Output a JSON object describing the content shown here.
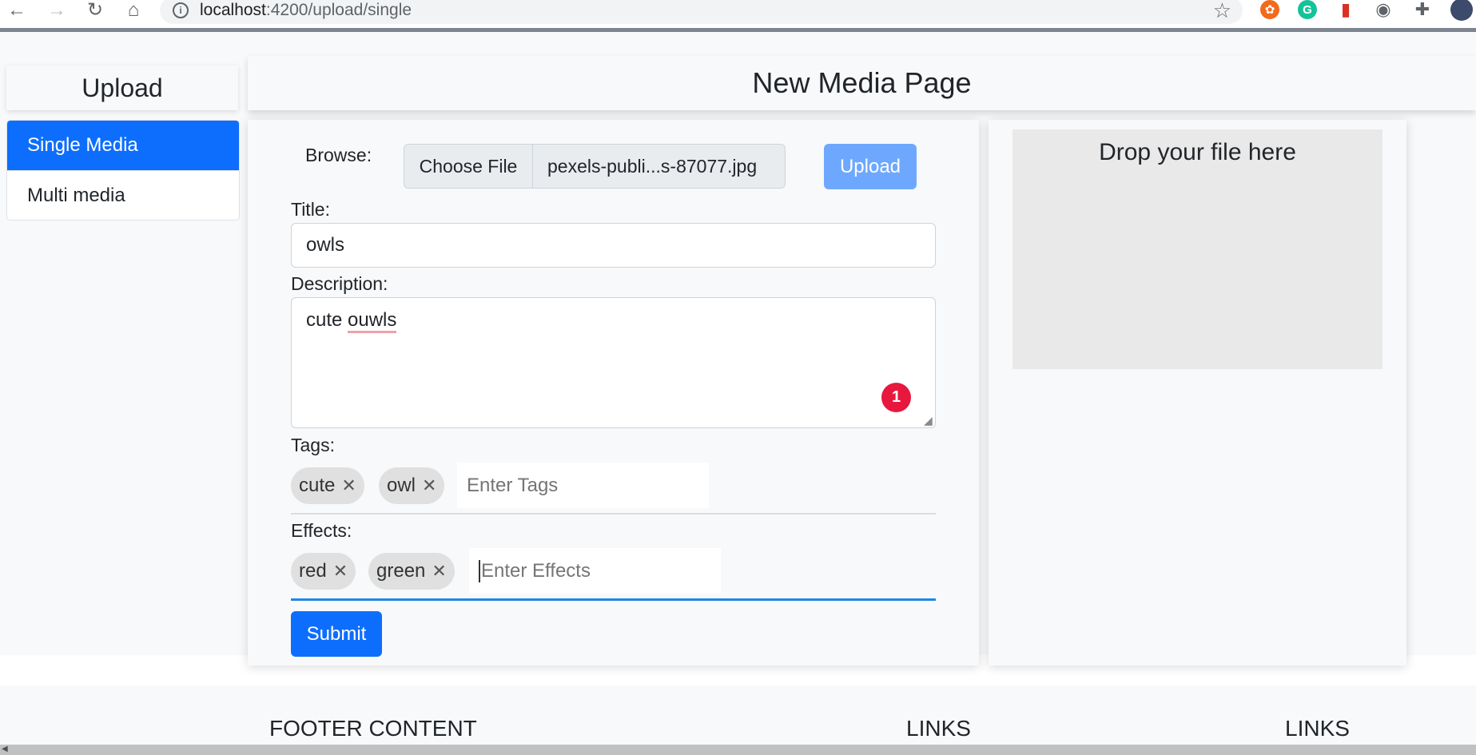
{
  "browser": {
    "url_host": "localhost",
    "url_path": ":4200/upload/single",
    "back_icon": "←",
    "forward_icon": "→",
    "reload_icon": "↻",
    "home_icon": "⌂",
    "info_icon": "i",
    "star_icon": "☆",
    "extensions": [
      {
        "name": "ublock-icon",
        "glyph": "✿",
        "color": "#f26b1d"
      },
      {
        "name": "grammarly-icon",
        "glyph": "G",
        "color": "#15c39a"
      },
      {
        "name": "bookmark-ext-icon",
        "glyph": "▮",
        "color": "#d93025"
      },
      {
        "name": "screencast-icon",
        "glyph": "◉",
        "color": "#5f6368"
      },
      {
        "name": "puzzle-icon",
        "glyph": "✚",
        "color": "#5f6368"
      }
    ]
  },
  "sidebar": {
    "title": "Upload",
    "items": [
      {
        "label": "Single Media",
        "active": true
      },
      {
        "label": "Multi media",
        "active": false
      }
    ]
  },
  "header": {
    "title": "New Media Page"
  },
  "form": {
    "browse_label": "Browse:",
    "choose_file_label": "Choose File",
    "file_name": "pexels-publi...s-87077.jpg",
    "upload_label": "Upload",
    "title_label": "Title:",
    "title_value": "owls",
    "description_label": "Description:",
    "description_value_plain": "cute ",
    "description_value_misspelled": "ouwls",
    "grammarly_count": "1",
    "tags_label": "Tags:",
    "tags": [
      "cute",
      "owl"
    ],
    "tags_placeholder": "Enter Tags",
    "effects_label": "Effects:",
    "effects": [
      "red",
      "green"
    ],
    "effects_placeholder": "Enter Effects",
    "submit_label": "Submit",
    "remove_glyph": "✕"
  },
  "dropzone": {
    "text": "Drop your file here"
  },
  "footer": {
    "content_heading": "FOOTER CONTENT",
    "links_heading_1": "LINKS",
    "links_heading_2": "LINKS"
  },
  "colors": {
    "primary": "#0d6efd",
    "primary_light": "#6ea8fe",
    "focus_blue": "#1e88e5",
    "grammarly_red": "#e8173e"
  }
}
